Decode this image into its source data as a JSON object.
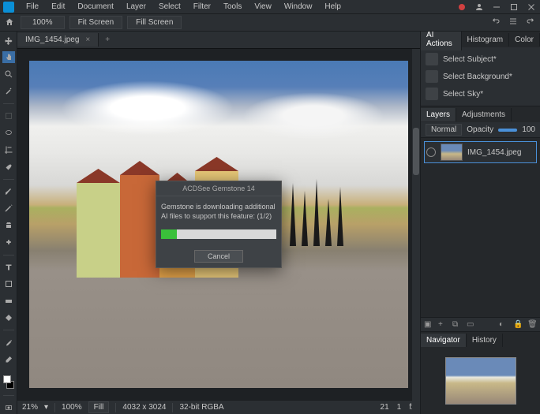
{
  "menu": [
    "File",
    "Edit",
    "Document",
    "Layer",
    "Select",
    "Filter",
    "Tools",
    "View",
    "Window",
    "Help"
  ],
  "toolbar": {
    "zoom": "100%",
    "fit_screen": "Fit Screen",
    "fill_screen": "Fill Screen"
  },
  "tab": {
    "name": "IMG_1454.jpeg"
  },
  "right_tabs": {
    "ai": "AI Actions",
    "hist": "Histogram",
    "color": "Color"
  },
  "ai": {
    "subject": "Select Subject*",
    "background": "Select Background*",
    "sky": "Select Sky*"
  },
  "layers": {
    "tab_layers": "Layers",
    "tab_adjust": "Adjustments",
    "mode": "Normal",
    "opacity_label": "Opacity",
    "opacity": "100",
    "item": "IMG_1454.jpeg"
  },
  "nav": {
    "tab_nav": "Navigator",
    "tab_hist": "History"
  },
  "status": {
    "zoom": "21%",
    "fill_pct": "100%",
    "fill": "Fill",
    "dims": "4032 x 3024",
    "bits": "32-bit RGBA",
    "num1": "21",
    "num2": "1"
  },
  "modal": {
    "title": "ACDSee Gemstone 14",
    "msg": "Gemstone is downloading additional AI files to support this feature: (1/2)",
    "cancel": "Cancel"
  }
}
